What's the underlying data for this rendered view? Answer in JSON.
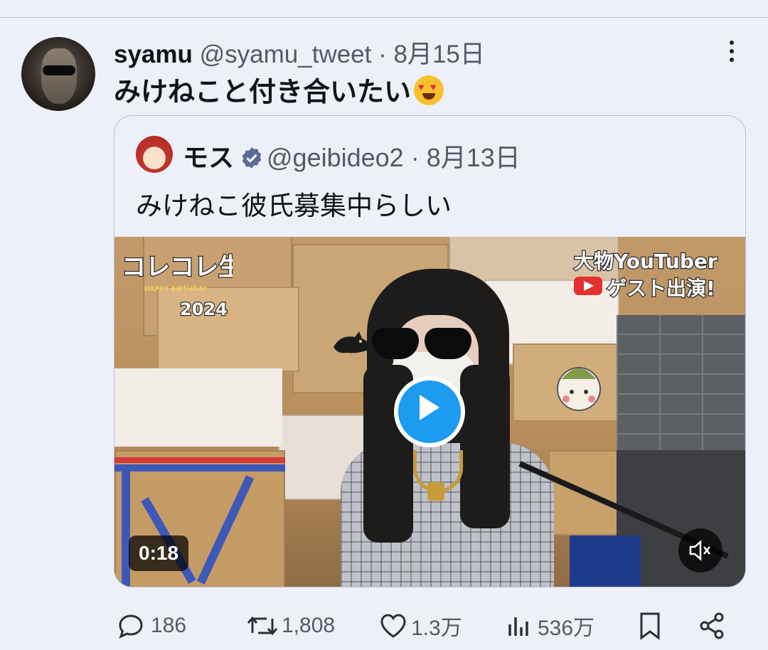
{
  "tweet": {
    "author_name": "syamu",
    "handle": "@syamu_tweet",
    "separator": " · ",
    "date": "8月15日",
    "text": "みけねこと付き合いたい",
    "emoji": "heart-eyes-emoji"
  },
  "quoted": {
    "author_name": "モス",
    "handle": "@geibideo2",
    "separator": " · ",
    "date": "8月13日",
    "text": "みけねこ彼氏募集中らしい",
    "verified": true,
    "media": {
      "duration": "0:18",
      "overlay_left": "コレコレ生誕祭",
      "overlay_left_small": "HAPPY BIRTHDAY",
      "overlay_left_year": "2024",
      "overlay_right_line1": "大物YouTuber",
      "overlay_right_line2": "ゲスト出演!"
    }
  },
  "actions": {
    "replies": "186",
    "reposts": "1,808",
    "likes": "1.3万",
    "views": "536万"
  },
  "colors": {
    "background": "#eef0f9",
    "text": "#0f1419",
    "muted": "#52596a",
    "accent": "#1d9bf0",
    "border": "#b7bfdb"
  }
}
